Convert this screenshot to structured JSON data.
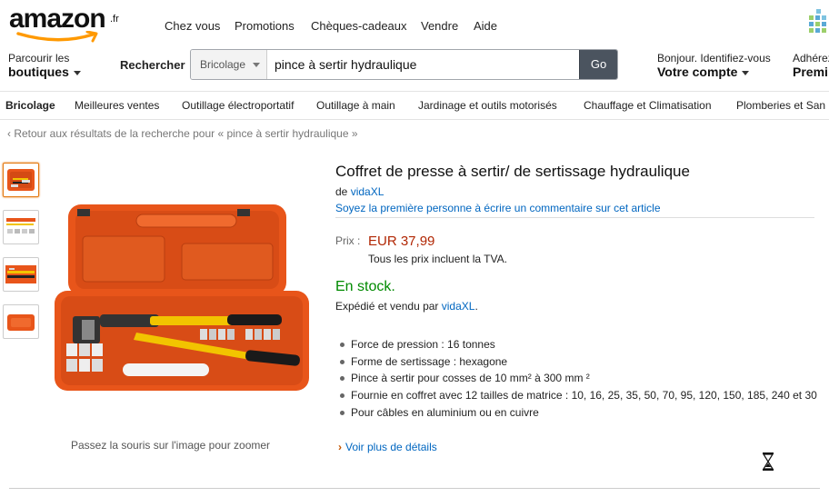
{
  "header": {
    "logo_text": "amazon",
    "logo_tld": ".fr",
    "links": [
      "Chez vous",
      "Promotions",
      "Chèques-cadeaux",
      "Vendre",
      "Aide"
    ]
  },
  "nav": {
    "browse_line1": "Parcourir les",
    "browse_line2": "boutiques",
    "search_label": "Rechercher",
    "search_category": "Bricolage",
    "search_value": "pince à sertir hydraulique",
    "search_button": "Go",
    "account_line1": "Bonjour. Identifiez-vous",
    "account_line2": "Votre compte",
    "prime_line1": "Adhérez",
    "prime_line2": "Premi"
  },
  "categories": [
    "Bricolage",
    "Meilleures ventes",
    "Outillage électroportatif",
    "Outillage à main",
    "Jardinage et outils motorisés",
    "Chauffage et Climatisation",
    "Plomberies et San"
  ],
  "breadcrumb": "‹ Retour aux résultats de la recherche pour « pince à sertir hydraulique »",
  "gallery": {
    "zoom_hint": "Passez la souris sur l'image pour zoomer"
  },
  "product": {
    "title": "Coffret de presse à sertir/ de sertissage hydraulique",
    "by_prefix": "de",
    "brand": "vidaXL",
    "review_link": "Soyez la première personne à écrire un commentaire sur cet article",
    "price_label": "Prix :",
    "price": "EUR 37,99",
    "vat_note": "Tous les prix incluent la TVA.",
    "stock": "En stock.",
    "ships_prefix": "Expédié et vendu par",
    "seller": "vidaXL",
    "bullets": [
      "Force de pression : 16 tonnes",
      "Forme de sertissage : hexagone",
      "Pince à sertir pour cosses de 10 mm² à 300 mm ²",
      "Fournie en coffret avec 12 tailles de matrice : 10, 16, 25, 35, 50, 70, 95, 120, 150, 185, 240 et 30",
      "Pour câbles en aluminium ou en cuivre"
    ],
    "more_details": "Voir plus de détails"
  },
  "colors": {
    "price": "#b12704",
    "stock": "#008a00",
    "link": "#0066c0",
    "case_orange": "#e8551a",
    "handle_yellow": "#f2c400"
  }
}
